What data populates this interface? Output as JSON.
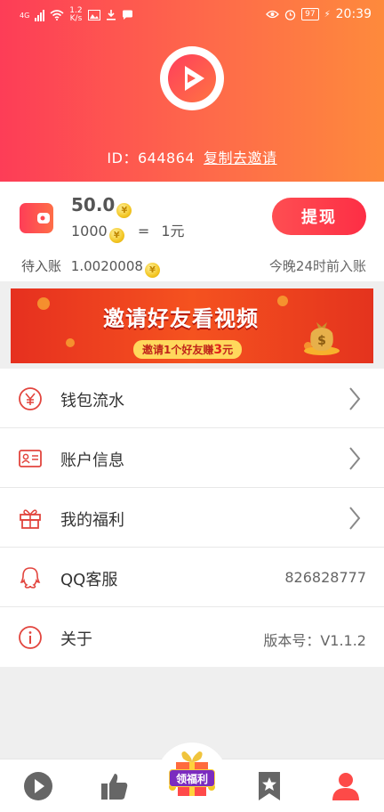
{
  "status_bar": {
    "network": "4G",
    "speed_value": "1.2",
    "speed_unit": "K/s",
    "battery": "97",
    "time": "20:39"
  },
  "header": {
    "id_text": "ID：644864",
    "copy_invite": "复制去邀请"
  },
  "wallet": {
    "balance": "50.0",
    "rate_coins": "1000",
    "rate_equals": "=",
    "rate_value": "1元",
    "withdraw_label": "提现",
    "pending_label": "待入账",
    "pending_value": "1.0020008",
    "tonight_note": "今晚24时前入账"
  },
  "banner": {
    "title": "邀请好友看视频",
    "sub_prefix": "邀请1个好友赚",
    "sub_amount": "3",
    "sub_suffix": "元"
  },
  "menu": {
    "items": [
      {
        "label": "钱包流水",
        "icon": "yen-circle-icon"
      },
      {
        "label": "账户信息",
        "icon": "id-card-icon"
      },
      {
        "label": "我的福利",
        "icon": "gift-icon"
      },
      {
        "label": "QQ客服",
        "icon": "qq-icon",
        "value": "826828777"
      },
      {
        "label": "关于",
        "icon": "info-icon",
        "value": "版本号：V1.1.2"
      }
    ]
  },
  "tabbar": {
    "tabs": [
      {
        "icon": "play-icon"
      },
      {
        "icon": "thumbs-up-icon"
      },
      {
        "icon": "gift-box-icon",
        "label": "领福利"
      },
      {
        "icon": "bookmark-star-icon"
      },
      {
        "icon": "person-icon",
        "active": true
      }
    ]
  },
  "colors": {
    "brand_red": "#fd3d57",
    "brand_orange": "#fe8a3c",
    "active_tab": "#fd4a48"
  }
}
